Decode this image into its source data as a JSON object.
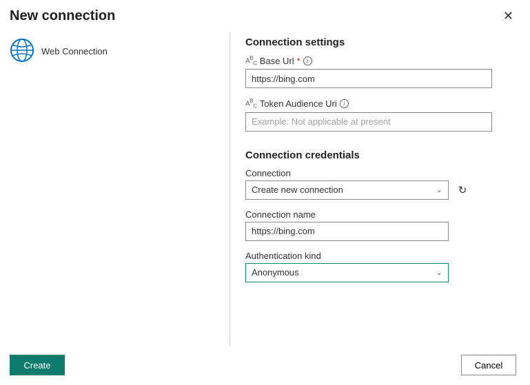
{
  "header": {
    "title": "New connection"
  },
  "sidebar": {
    "connection_type_label": "Web Connection"
  },
  "settings": {
    "title": "Connection settings",
    "base_url": {
      "label": "Base Url",
      "required_mark": "*",
      "value": "https://bing.com"
    },
    "token_audience": {
      "label": "Token Audience Uri",
      "placeholder": "Example: Not applicable at present",
      "value": ""
    }
  },
  "credentials": {
    "title": "Connection credentials",
    "connection": {
      "label": "Connection",
      "selected": "Create new connection"
    },
    "connection_name": {
      "label": "Connection name",
      "value": "https://bing.com"
    },
    "auth_kind": {
      "label": "Authentication kind",
      "selected": "Anonymous"
    }
  },
  "footer": {
    "create_label": "Create",
    "cancel_label": "Cancel"
  }
}
